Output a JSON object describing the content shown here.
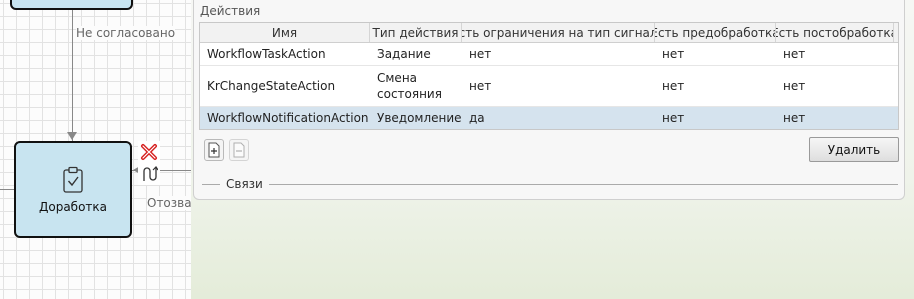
{
  "canvas": {
    "edge_label_top": "Не согласовано",
    "edge_label_right": "Отозва",
    "node_main_label": "Доработка",
    "icons": {
      "node_icon": "clipboard-check-icon",
      "delete_control": "red-x-icon",
      "reroute_control": "reroute-icon"
    }
  },
  "actions": {
    "section_title": "Действия",
    "columns": [
      "Имя",
      "Тип действия",
      "Есть ограничения на тип сигнала",
      "Есть предобработка",
      "Есть постобработка"
    ],
    "rows": [
      [
        "WorkflowTaskAction",
        "Задание",
        "нет",
        "нет",
        "нет"
      ],
      [
        "KrChangeStateAction",
        "Смена\nсостояния",
        "нет",
        "нет",
        "нет"
      ],
      [
        "WorkflowNotificationAction",
        "Уведомление",
        "да",
        "нет",
        "нет"
      ]
    ],
    "selected_row": 2,
    "add_button_icon": "add-document-icon",
    "remove_button_icon": "remove-document-icon",
    "delete_label": "Удалить"
  },
  "links": {
    "label": "Связи"
  },
  "colors": {
    "node_fill": "#c8e4f0",
    "selected_row": "#d5e3ee",
    "accent_red": "#d62020"
  }
}
